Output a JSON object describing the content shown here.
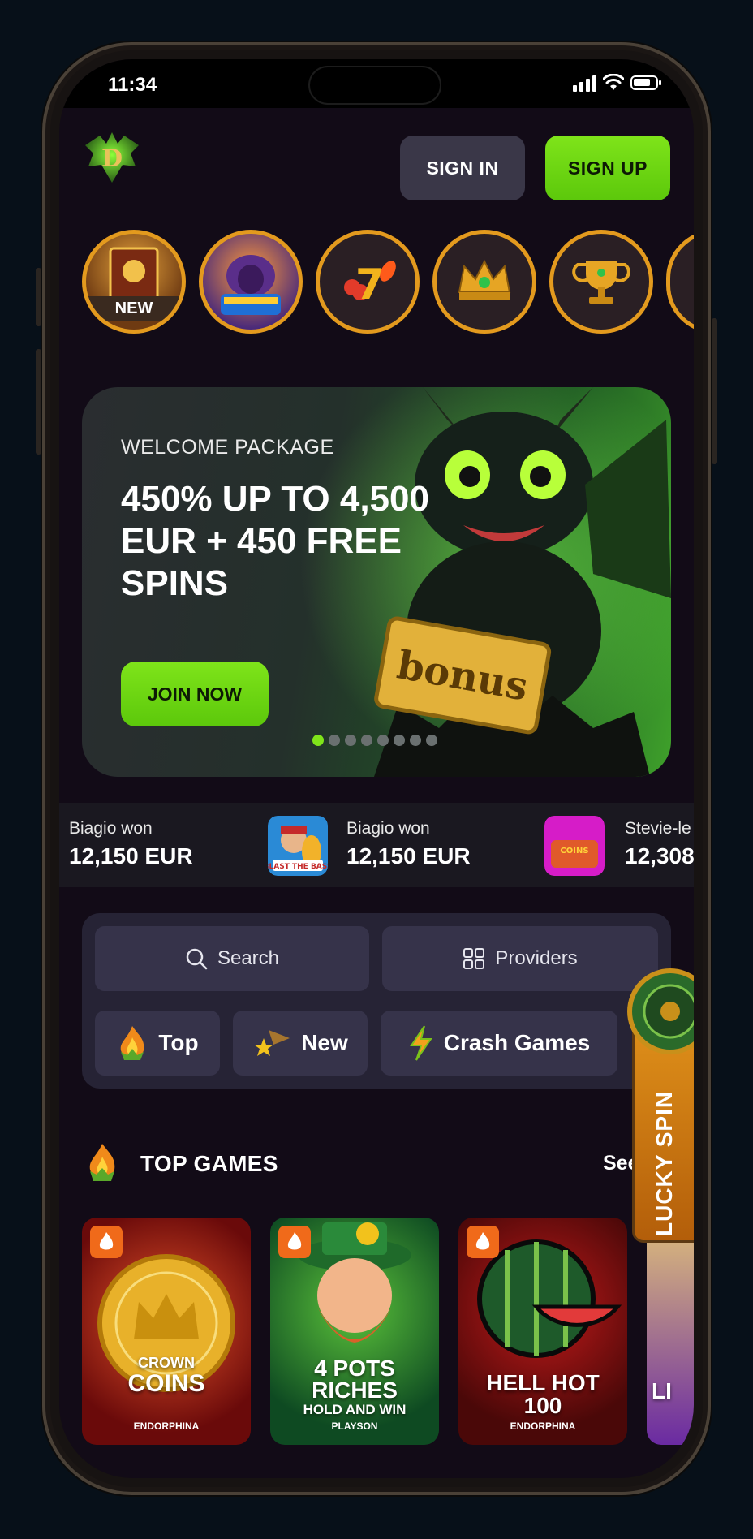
{
  "status_bar": {
    "time": "11:34"
  },
  "header": {
    "sign_in": "SIGN IN",
    "sign_up": "SIGN UP"
  },
  "stories": [
    {
      "name": "book-of-the-hid",
      "badge": "NEW"
    },
    {
      "name": "buffalo-power-megaways",
      "badge": ""
    },
    {
      "name": "fruit-seven",
      "badge": ""
    },
    {
      "name": "crown",
      "badge": ""
    },
    {
      "name": "trophy",
      "badge": ""
    }
  ],
  "banner": {
    "subtitle": "WELCOME PACKAGE",
    "title": "450% UP TO 4,500 EUR + 450 FREE SPINS",
    "cta": "JOIN NOW",
    "badge_text": "bonus",
    "dot_count": 8,
    "active_dot": 0
  },
  "winners": [
    {
      "who": "Biagio won",
      "amount": "12,150 EUR",
      "game": ""
    },
    {
      "who": "Biagio won",
      "amount": "12,150 EUR",
      "game": "BLAST THE BASS"
    },
    {
      "who": "Stevie-le",
      "amount": "12,308",
      "game": "COINS"
    }
  ],
  "filters": {
    "search": "Search",
    "providers": "Providers",
    "tabs": [
      {
        "label": "Top",
        "icon": "fire-icon"
      },
      {
        "label": "New",
        "icon": "shooting-star-icon"
      },
      {
        "label": "Crash Games",
        "icon": "lightning-icon"
      }
    ]
  },
  "lucky_spin": "LUCKY SPIN",
  "top_games": {
    "title": "TOP GAMES",
    "see_all": "See",
    "games": [
      {
        "title_1": "CROWN",
        "title_2": "COINS",
        "extra": "",
        "provider": "ENDORPHINA"
      },
      {
        "title_1": "4 POTS",
        "title_2": "RICHES",
        "extra": "HOLD AND WIN",
        "provider": "PLAYSON"
      },
      {
        "title_1": "HELL HOT",
        "title_2": "100",
        "extra": "",
        "provider": "ENDORPHINA"
      },
      {
        "title_1": "LI",
        "title_2": "",
        "extra": "",
        "provider": ""
      }
    ]
  },
  "colors": {
    "accent": "#7fe41a",
    "story_ring": "#e39a1e",
    "panel": "#262335",
    "pill": "#36334a",
    "fire_badge": "#f06a1a"
  }
}
